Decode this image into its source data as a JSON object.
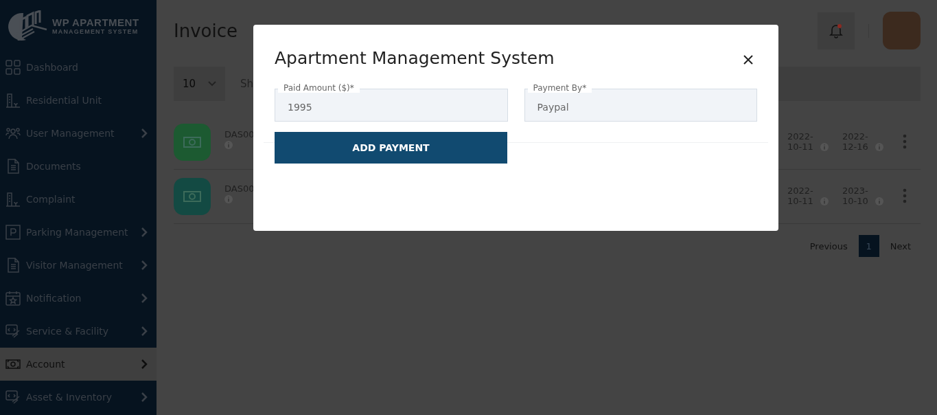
{
  "sidebar": {
    "logo": {
      "title": "WP APARTMENT",
      "subtitle": "MANAGEMENT SYSTEM"
    },
    "items": [
      {
        "label": "Dashboard",
        "kind": "grid",
        "expandable": false,
        "selected": false
      },
      {
        "label": "Residential Unit",
        "kind": "building",
        "expandable": false,
        "selected": false
      },
      {
        "label": "User Management",
        "kind": "users",
        "expandable": true,
        "selected": false
      },
      {
        "label": "Documents",
        "kind": "document",
        "expandable": false,
        "selected": false
      },
      {
        "label": "Complaint",
        "kind": "building",
        "expandable": false,
        "selected": false
      },
      {
        "label": "Parking Management",
        "kind": "parking",
        "expandable": true,
        "selected": false
      },
      {
        "label": "Visitor Management",
        "kind": "document",
        "expandable": true,
        "selected": false
      },
      {
        "label": "Notification",
        "kind": "calendar",
        "expandable": true,
        "selected": false
      },
      {
        "label": "Service & Facility",
        "kind": "service",
        "expandable": true,
        "selected": false
      },
      {
        "label": "Account",
        "kind": "money",
        "expandable": true,
        "selected": true
      },
      {
        "label": "Asset & Inventory",
        "kind": "service",
        "expandable": true,
        "selected": false
      }
    ]
  },
  "page": {
    "title": "Invoice"
  },
  "header": {
    "unread": true
  },
  "toolbar": {
    "page_size": "10",
    "text": "Sh"
  },
  "rows": [
    {
      "code": "DAS00",
      "color": "#1c5a31",
      "date_1": "2022-10-11",
      "date_2": "2022-12-16"
    },
    {
      "code": "DAS00",
      "color": "#134a43",
      "date_1": "2022-10-11",
      "date_2": "2023-10-10"
    }
  ],
  "pagination": {
    "previous": "Previous",
    "pages": [
      {
        "label": "1",
        "selected": true
      }
    ],
    "next": "Next"
  },
  "modal": {
    "title": "Apartment Management System",
    "fields": [
      {
        "label": "Paid Amount ($)*",
        "value": "1995"
      },
      {
        "label": "Payment By*",
        "value": "Paypal"
      }
    ],
    "button": "ADD PAYMENT"
  }
}
